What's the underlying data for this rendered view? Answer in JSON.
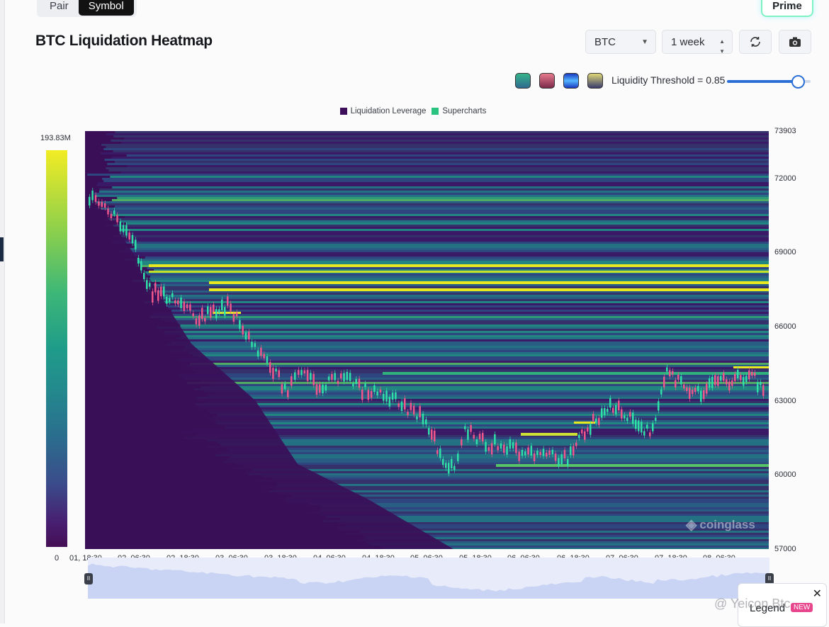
{
  "tabs": {
    "pair": "Pair",
    "symbol": "Symbol"
  },
  "prime_label": "Prime",
  "title": "BTC Liquidation Heatmap",
  "symbol_select": "BTC",
  "range_select": "1 week",
  "threshold": {
    "label": "Liquidity Threshold = 0.85",
    "value": 0.85
  },
  "swatches": [
    {
      "name": "green-palette",
      "color": "#2aa98a"
    },
    {
      "name": "red-palette",
      "color": "#d9627a"
    },
    {
      "name": "blue-palette",
      "color": "#1f44e8"
    },
    {
      "name": "yellow-palette",
      "color": "#c9c05a"
    }
  ],
  "legend": [
    {
      "label": "Liquidation Leverage",
      "color": "#3d0f5a"
    },
    {
      "label": "Supercharts",
      "color": "#29c37f"
    }
  ],
  "colorbar": {
    "max": "193.83M",
    "min": "0"
  },
  "yaxis": [
    "73903",
    "72000",
    "69000",
    "66000",
    "63000",
    "60000",
    "57000"
  ],
  "xaxis": [
    "01, 18:30",
    "02, 06:30",
    "02, 18:30",
    "03, 06:30",
    "03, 18:30",
    "04, 06:30",
    "04, 18:30",
    "05, 06:30",
    "05, 18:30",
    "06, 06:30",
    "06, 18:30",
    "07, 06:30",
    "07, 18:30",
    "08, 06:30"
  ],
  "watermark": "coinglass",
  "legend_button": {
    "label": "Legend",
    "badge": "NEW"
  },
  "signature": "@ Yeicon Btc",
  "colors": {
    "heat_bg": "#3a0f58",
    "up": "#2fe0a8",
    "down": "#f0568c",
    "accent": "#2b6fd6"
  }
}
